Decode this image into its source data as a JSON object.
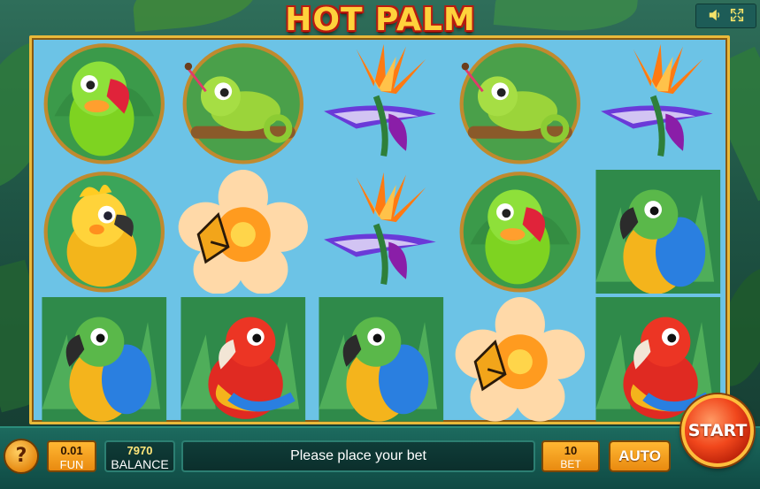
{
  "game": {
    "title": "HOT PALM"
  },
  "system_buttons": [
    {
      "name": "sound-icon",
      "glyph": "🔊"
    },
    {
      "name": "fullscreen-icon",
      "glyph": "⤢"
    }
  ],
  "reels": {
    "columns": 5,
    "rows": 3,
    "symbols": [
      [
        "lovebird",
        "sun-conure",
        "macaw-blue"
      ],
      [
        "chameleon",
        "hibiscus-butterfly",
        "macaw-red"
      ],
      [
        "bird-of-paradise",
        "bird-of-paradise",
        "macaw-blue"
      ],
      [
        "chameleon",
        "lovebird",
        "hibiscus-butterfly"
      ],
      [
        "bird-of-paradise",
        "macaw-blue",
        "macaw-red"
      ]
    ]
  },
  "controls": {
    "help_label": "?",
    "coin_value": "0.01",
    "coin_label": "FUN",
    "balance_value": "7970",
    "balance_label": "BALANCE",
    "message": "Please place your bet",
    "bet_value": "10",
    "bet_label": "BET",
    "auto_label": "AUTO",
    "start_label": "START"
  },
  "colors": {
    "title_fill": "#ffd23c",
    "title_outline": "#b81b10",
    "reel_background": "#6cc3e6",
    "frame_gold": "#e9b93a",
    "panel_teal": "#1c6a5e",
    "button_orange": "#e98a10",
    "start_red": "#f1471c"
  }
}
